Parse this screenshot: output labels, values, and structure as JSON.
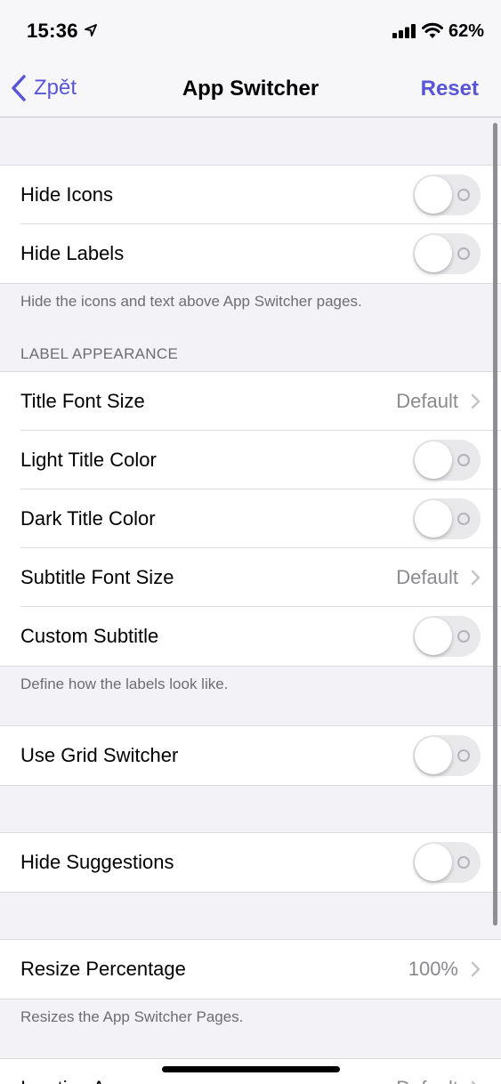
{
  "status_bar": {
    "time": "15:36",
    "battery": "62%",
    "icons": [
      "location-arrow-icon",
      "cellular-signal-icon",
      "wifi-icon"
    ]
  },
  "nav": {
    "back_label": "Zpět",
    "title": "App Switcher",
    "reset_label": "Reset"
  },
  "groups": {
    "visibility": {
      "hide_icons": "Hide Icons",
      "hide_labels": "Hide Labels",
      "footer": "Hide the icons and text above App Switcher pages."
    },
    "label_appearance": {
      "header": "LABEL APPEARANCE",
      "title_font_size": "Title Font Size",
      "title_font_size_value": "Default",
      "light_title_color": "Light Title Color",
      "dark_title_color": "Dark Title Color",
      "subtitle_font_size": "Subtitle Font Size",
      "subtitle_font_size_value": "Default",
      "custom_subtitle": "Custom Subtitle",
      "footer": "Define how the labels look like."
    },
    "grid": {
      "use_grid_switcher": "Use Grid Switcher"
    },
    "suggestions": {
      "hide_suggestions": "Hide Suggestions"
    },
    "resize": {
      "resize_percentage": "Resize Percentage",
      "resize_percentage_value": "100%",
      "footer": "Resizes the App Switcher Pages."
    },
    "inactive": {
      "inactive_apps": "Inactive Apps",
      "inactive_apps_value": "Default"
    }
  },
  "toggles": {
    "hide_icons": false,
    "hide_labels": false,
    "light_title_color": false,
    "dark_title_color": false,
    "custom_subtitle": false,
    "use_grid_switcher": false,
    "hide_suggestions": false
  },
  "colors": {
    "accent": "#5856d6",
    "background": "#f2f2f7",
    "toggle_off": "#e9e9eb",
    "secondary_text": "#8a8a8e"
  }
}
